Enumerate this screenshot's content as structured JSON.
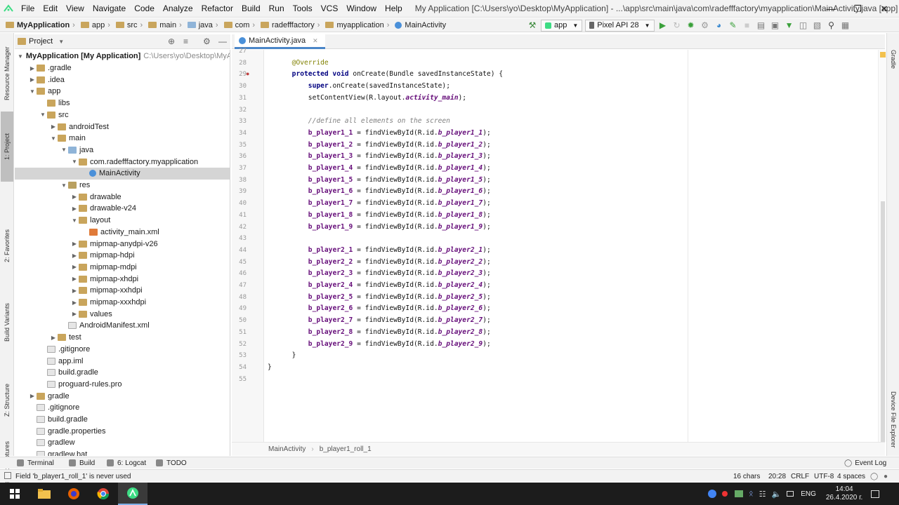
{
  "menubar": {
    "items": [
      "File",
      "Edit",
      "View",
      "Navigate",
      "Code",
      "Analyze",
      "Refactor",
      "Build",
      "Run",
      "Tools",
      "VCS",
      "Window",
      "Help"
    ],
    "window_title": "My Application [C:\\Users\\yo\\Desktop\\MyApplication] - ...\\app\\src\\main\\java\\com\\radefffactory\\myapplication\\MainActivity.java [app]",
    "minimize": "—",
    "restore": "❐",
    "close": "✕"
  },
  "navbar": {
    "crumbs": [
      "MyApplication",
      "app",
      "src",
      "main",
      "java",
      "com",
      "radefffactory",
      "myapplication",
      "MainActivity"
    ],
    "run_config": "app",
    "device": "Pixel API 28"
  },
  "left_strip": {
    "tabs": [
      "Resource Manager",
      "1: Project",
      "2: Favorites",
      "Build Variants",
      "Z: Structure",
      "Layout Captures"
    ]
  },
  "right_strip": {
    "tabs": [
      "Gradle",
      "Device File Explorer"
    ]
  },
  "project": {
    "title": "Project",
    "tree": [
      {
        "label": "MyApplication [My Application]",
        "extra": "C:\\Users\\yo\\Desktop\\MyApp",
        "indent": 0,
        "arrow": "open",
        "icon": "folder"
      },
      {
        "label": ".gradle",
        "indent": 1,
        "arrow": "closed",
        "icon": "folder"
      },
      {
        "label": ".idea",
        "indent": 1,
        "arrow": "closed",
        "icon": "folder"
      },
      {
        "label": "app",
        "indent": 1,
        "arrow": "open",
        "icon": "folder"
      },
      {
        "label": "libs",
        "indent": 2,
        "arrow": "",
        "icon": "folder"
      },
      {
        "label": "src",
        "indent": 2,
        "arrow": "open",
        "icon": "folder"
      },
      {
        "label": "androidTest",
        "indent": 3,
        "arrow": "closed",
        "icon": "folder"
      },
      {
        "label": "main",
        "indent": 3,
        "arrow": "open",
        "icon": "folder"
      },
      {
        "label": "java",
        "indent": 4,
        "arrow": "open",
        "icon": "bluef"
      },
      {
        "label": "com.radefffactory.myapplication",
        "indent": 5,
        "arrow": "open",
        "icon": "folder"
      },
      {
        "label": "MainActivity",
        "indent": 6,
        "arrow": "",
        "icon": "cls",
        "selected": true
      },
      {
        "label": "res",
        "indent": 4,
        "arrow": "open",
        "icon": "res"
      },
      {
        "label": "drawable",
        "indent": 5,
        "arrow": "closed",
        "icon": "folder"
      },
      {
        "label": "drawable-v24",
        "indent": 5,
        "arrow": "closed",
        "icon": "folder"
      },
      {
        "label": "layout",
        "indent": 5,
        "arrow": "open",
        "icon": "folder"
      },
      {
        "label": "activity_main.xml",
        "indent": 6,
        "arrow": "",
        "icon": "xml"
      },
      {
        "label": "mipmap-anydpi-v26",
        "indent": 5,
        "arrow": "closed",
        "icon": "folder"
      },
      {
        "label": "mipmap-hdpi",
        "indent": 5,
        "arrow": "closed",
        "icon": "folder"
      },
      {
        "label": "mipmap-mdpi",
        "indent": 5,
        "arrow": "closed",
        "icon": "folder"
      },
      {
        "label": "mipmap-xhdpi",
        "indent": 5,
        "arrow": "closed",
        "icon": "folder"
      },
      {
        "label": "mipmap-xxhdpi",
        "indent": 5,
        "arrow": "closed",
        "icon": "folder"
      },
      {
        "label": "mipmap-xxxhdpi",
        "indent": 5,
        "arrow": "closed",
        "icon": "folder"
      },
      {
        "label": "values",
        "indent": 5,
        "arrow": "closed",
        "icon": "folder"
      },
      {
        "label": "AndroidManifest.xml",
        "indent": 4,
        "arrow": "",
        "icon": "file"
      },
      {
        "label": "test",
        "indent": 3,
        "arrow": "closed",
        "icon": "folder"
      },
      {
        "label": ".gitignore",
        "indent": 2,
        "arrow": "",
        "icon": "file"
      },
      {
        "label": "app.iml",
        "indent": 2,
        "arrow": "",
        "icon": "file"
      },
      {
        "label": "build.gradle",
        "indent": 2,
        "arrow": "",
        "icon": "file"
      },
      {
        "label": "proguard-rules.pro",
        "indent": 2,
        "arrow": "",
        "icon": "file"
      },
      {
        "label": "gradle",
        "indent": 1,
        "arrow": "closed",
        "icon": "folder"
      },
      {
        "label": ".gitignore",
        "indent": 1,
        "arrow": "",
        "icon": "file"
      },
      {
        "label": "build.gradle",
        "indent": 1,
        "arrow": "",
        "icon": "file"
      },
      {
        "label": "gradle.properties",
        "indent": 1,
        "arrow": "",
        "icon": "file"
      },
      {
        "label": "gradlew",
        "indent": 1,
        "arrow": "",
        "icon": "file"
      },
      {
        "label": "gradlew.bat",
        "indent": 1,
        "arrow": "",
        "icon": "file"
      }
    ]
  },
  "editor": {
    "tab": "MainActivity.java",
    "first_line_number": 27,
    "lines": [
      {
        "n": "27",
        "indent": 0,
        "segs": []
      },
      {
        "n": "28",
        "indent": 6,
        "segs": [
          [
            "ann",
            "@Override"
          ]
        ]
      },
      {
        "n": "29",
        "indent": 6,
        "segs": [
          [
            "kw",
            "protected void "
          ],
          [
            "",
            "onCreate(Bundle savedInstanceState) {"
          ]
        ]
      },
      {
        "n": "30",
        "indent": 10,
        "segs": [
          [
            "kw",
            "super"
          ],
          [
            "",
            ".onCreate(savedInstanceState);"
          ]
        ]
      },
      {
        "n": "31",
        "indent": 10,
        "segs": [
          [
            "",
            "setContentView(R.layout."
          ],
          [
            "ital",
            "activity_main"
          ],
          [
            "",
            ");"
          ]
        ]
      },
      {
        "n": "32",
        "indent": 0,
        "segs": []
      },
      {
        "n": "33",
        "indent": 10,
        "segs": [
          [
            "cmt",
            "//define all elements on the screen"
          ]
        ]
      },
      {
        "n": "34",
        "indent": 10,
        "segs": [
          [
            "fld",
            "b_player1_1"
          ],
          [
            "",
            " = findViewById(R.id."
          ],
          [
            "ital",
            "b_player1_1"
          ],
          [
            "",
            ");"
          ]
        ]
      },
      {
        "n": "35",
        "indent": 10,
        "segs": [
          [
            "fld",
            "b_player1_2"
          ],
          [
            "",
            " = findViewById(R.id."
          ],
          [
            "ital",
            "b_player1_2"
          ],
          [
            "",
            ");"
          ]
        ]
      },
      {
        "n": "36",
        "indent": 10,
        "segs": [
          [
            "fld",
            "b_player1_3"
          ],
          [
            "",
            " = findViewById(R.id."
          ],
          [
            "ital",
            "b_player1_3"
          ],
          [
            "",
            ");"
          ]
        ]
      },
      {
        "n": "37",
        "indent": 10,
        "segs": [
          [
            "fld",
            "b_player1_4"
          ],
          [
            "",
            " = findViewById(R.id."
          ],
          [
            "ital",
            "b_player1_4"
          ],
          [
            "",
            ");"
          ]
        ]
      },
      {
        "n": "38",
        "indent": 10,
        "segs": [
          [
            "fld",
            "b_player1_5"
          ],
          [
            "",
            " = findViewById(R.id."
          ],
          [
            "ital",
            "b_player1_5"
          ],
          [
            "",
            ");"
          ]
        ]
      },
      {
        "n": "39",
        "indent": 10,
        "segs": [
          [
            "fld",
            "b_player1_6"
          ],
          [
            "",
            " = findViewById(R.id."
          ],
          [
            "ital",
            "b_player1_6"
          ],
          [
            "",
            ");"
          ]
        ]
      },
      {
        "n": "40",
        "indent": 10,
        "segs": [
          [
            "fld",
            "b_player1_7"
          ],
          [
            "",
            " = findViewById(R.id."
          ],
          [
            "ital",
            "b_player1_7"
          ],
          [
            "",
            ");"
          ]
        ]
      },
      {
        "n": "41",
        "indent": 10,
        "segs": [
          [
            "fld",
            "b_player1_8"
          ],
          [
            "",
            " = findViewById(R.id."
          ],
          [
            "ital",
            "b_player1_8"
          ],
          [
            "",
            ");"
          ]
        ]
      },
      {
        "n": "42",
        "indent": 10,
        "segs": [
          [
            "fld",
            "b_player1_9"
          ],
          [
            "",
            " = findViewById(R.id."
          ],
          [
            "ital",
            "b_player1_9"
          ],
          [
            "",
            ");"
          ]
        ]
      },
      {
        "n": "43",
        "indent": 0,
        "segs": []
      },
      {
        "n": "44",
        "indent": 10,
        "segs": [
          [
            "fld",
            "b_player2_1"
          ],
          [
            "",
            " = findViewById(R.id."
          ],
          [
            "ital",
            "b_player2_1"
          ],
          [
            "",
            ");"
          ]
        ]
      },
      {
        "n": "45",
        "indent": 10,
        "segs": [
          [
            "fld",
            "b_player2_2"
          ],
          [
            "",
            " = findViewById(R.id."
          ],
          [
            "ital",
            "b_player2_2"
          ],
          [
            "",
            ");"
          ]
        ]
      },
      {
        "n": "46",
        "indent": 10,
        "segs": [
          [
            "fld",
            "b_player2_3"
          ],
          [
            "",
            " = findViewById(R.id."
          ],
          [
            "ital",
            "b_player2_3"
          ],
          [
            "",
            ");"
          ]
        ]
      },
      {
        "n": "47",
        "indent": 10,
        "segs": [
          [
            "fld",
            "b_player2_4"
          ],
          [
            "",
            " = findViewById(R.id."
          ],
          [
            "ital",
            "b_player2_4"
          ],
          [
            "",
            ");"
          ]
        ]
      },
      {
        "n": "48",
        "indent": 10,
        "segs": [
          [
            "fld",
            "b_player2_5"
          ],
          [
            "",
            " = findViewById(R.id."
          ],
          [
            "ital",
            "b_player2_5"
          ],
          [
            "",
            ");"
          ]
        ]
      },
      {
        "n": "49",
        "indent": 10,
        "segs": [
          [
            "fld",
            "b_player2_6"
          ],
          [
            "",
            " = findViewById(R.id."
          ],
          [
            "ital",
            "b_player2_6"
          ],
          [
            "",
            ");"
          ]
        ]
      },
      {
        "n": "50",
        "indent": 10,
        "segs": [
          [
            "fld",
            "b_player2_7"
          ],
          [
            "",
            " = findViewById(R.id."
          ],
          [
            "ital",
            "b_player2_7"
          ],
          [
            "",
            ");"
          ]
        ]
      },
      {
        "n": "51",
        "indent": 10,
        "segs": [
          [
            "fld",
            "b_player2_8"
          ],
          [
            "",
            " = findViewById(R.id."
          ],
          [
            "ital",
            "b_player2_8"
          ],
          [
            "",
            ");"
          ]
        ]
      },
      {
        "n": "52",
        "indent": 10,
        "segs": [
          [
            "fld",
            "b_player2_9"
          ],
          [
            "",
            " = findViewById(R.id."
          ],
          [
            "ital",
            "b_player2_9"
          ],
          [
            "",
            ");"
          ]
        ]
      },
      {
        "n": "53",
        "indent": 6,
        "segs": [
          [
            "",
            "}"
          ]
        ]
      },
      {
        "n": "54",
        "indent": 0,
        "segs": [
          [
            "",
            "}"
          ]
        ]
      },
      {
        "n": "55",
        "indent": 0,
        "segs": []
      }
    ],
    "breadcrumbs": [
      "MainActivity",
      "b_player1_roll_1"
    ]
  },
  "toolwindows": [
    {
      "label": "Terminal"
    },
    {
      "label": "Build"
    },
    {
      "label": "6: Logcat"
    },
    {
      "label": "TODO"
    }
  ],
  "event_log": "Event Log",
  "status": {
    "message": "Field 'b_player1_roll_1' is never used",
    "chars": "16 chars",
    "position": "20:28",
    "line_sep": "CRLF",
    "encoding": "UTF-8",
    "indent": "4 spaces"
  },
  "taskbar": {
    "lang": "ENG",
    "time": "14:04",
    "date": "26.4.2020 г."
  }
}
